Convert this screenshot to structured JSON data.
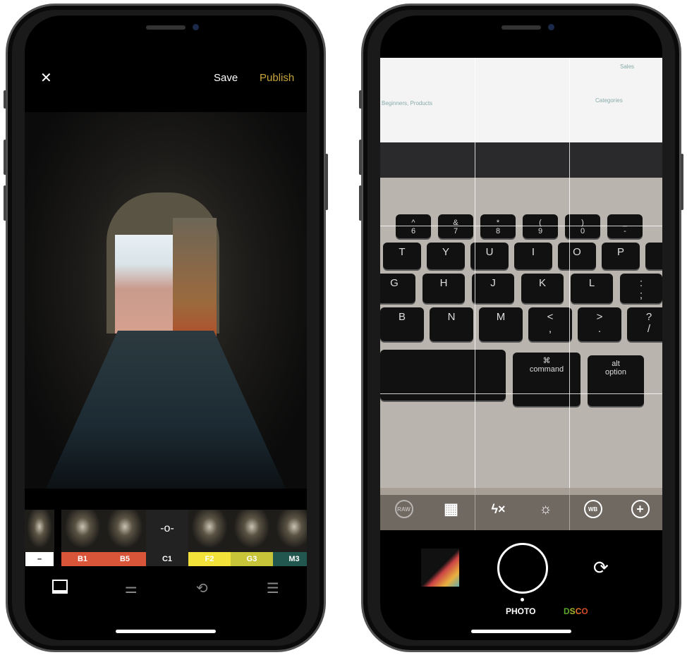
{
  "editor": {
    "close_icon": "close-icon",
    "save": "Save",
    "publish": "Publish",
    "publish_color": "#c8a43c",
    "filters": [
      {
        "label": "–",
        "bg": "#ffffff",
        "fg": "#000000"
      },
      {
        "label": "B1",
        "bg": "#d9553a",
        "fg": "#ffffff"
      },
      {
        "label": "B5",
        "bg": "#d9553a",
        "fg": "#ffffff"
      },
      {
        "label": "C1",
        "bg": "#222222",
        "fg": "#ffffff"
      },
      {
        "label": "F2",
        "bg": "#f2e23a",
        "fg": "#ffffff"
      },
      {
        "label": "G3",
        "bg": "#c8c43a",
        "fg": "#ffffff"
      },
      {
        "label": "M3",
        "bg": "#22574f",
        "fg": "#ffffff"
      }
    ],
    "tabs": [
      "image-icon",
      "sliders-icon",
      "history-icon",
      "recipes-icon"
    ]
  },
  "camera": {
    "paper_text": [
      "Sales",
      "Categories",
      "Beginners, Products"
    ],
    "keys": {
      "numbers": [
        "^\n6",
        "&\n7",
        "*\n8",
        "(\n9",
        ")\n0",
        "_\n-"
      ],
      "row1": [
        "T",
        "Y",
        "U",
        "I",
        "O",
        "P",
        "{\n["
      ],
      "row2": [
        "G",
        "H",
        "J",
        "K",
        "L",
        ":\n;"
      ],
      "row3": [
        "B",
        "N",
        "M",
        "<\n,",
        ">\n.",
        "?\n/"
      ],
      "command": "⌘\ncommand",
      "alt": "alt\noption"
    },
    "controls": [
      "RAW",
      "grid-icon",
      "flash-off-icon",
      "exposure-icon",
      "WB",
      "plus-icon"
    ],
    "modes": {
      "photo": "PHOTO",
      "dsco": "DSCO"
    },
    "dsco_colors": [
      "#5aa82a",
      "#a8b82a",
      "#e0702a",
      "#d04a2a"
    ]
  }
}
